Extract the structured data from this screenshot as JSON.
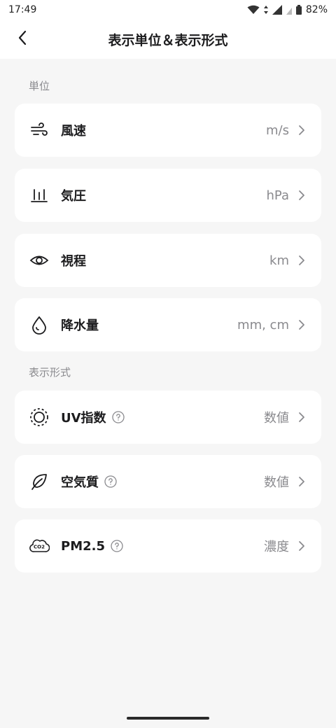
{
  "status_bar": {
    "time": "17:49",
    "battery": "82%"
  },
  "header": {
    "title": "表示単位＆表示形式"
  },
  "units_section": {
    "label": "単位",
    "items": [
      {
        "label": "風速",
        "value": "m/s",
        "icon": "wind-icon"
      },
      {
        "label": "気圧",
        "value": "hPa",
        "icon": "pressure-icon"
      },
      {
        "label": "視程",
        "value": "km",
        "icon": "eye-icon"
      },
      {
        "label": "降水量",
        "value": "mm, cm",
        "icon": "droplet-icon"
      }
    ]
  },
  "display_section": {
    "label": "表示形式",
    "items": [
      {
        "label": "UV指数",
        "value": "数値",
        "icon": "uv-icon",
        "help": true
      },
      {
        "label": "空気質",
        "value": "数値",
        "icon": "leaf-icon",
        "help": true
      },
      {
        "label": "PM2.5",
        "value": "濃度",
        "icon": "co2-cloud-icon",
        "help": true
      }
    ]
  },
  "colors": {
    "background": "#f6f6f6",
    "card": "#ffffff",
    "secondary_text": "#8a8a8e"
  }
}
